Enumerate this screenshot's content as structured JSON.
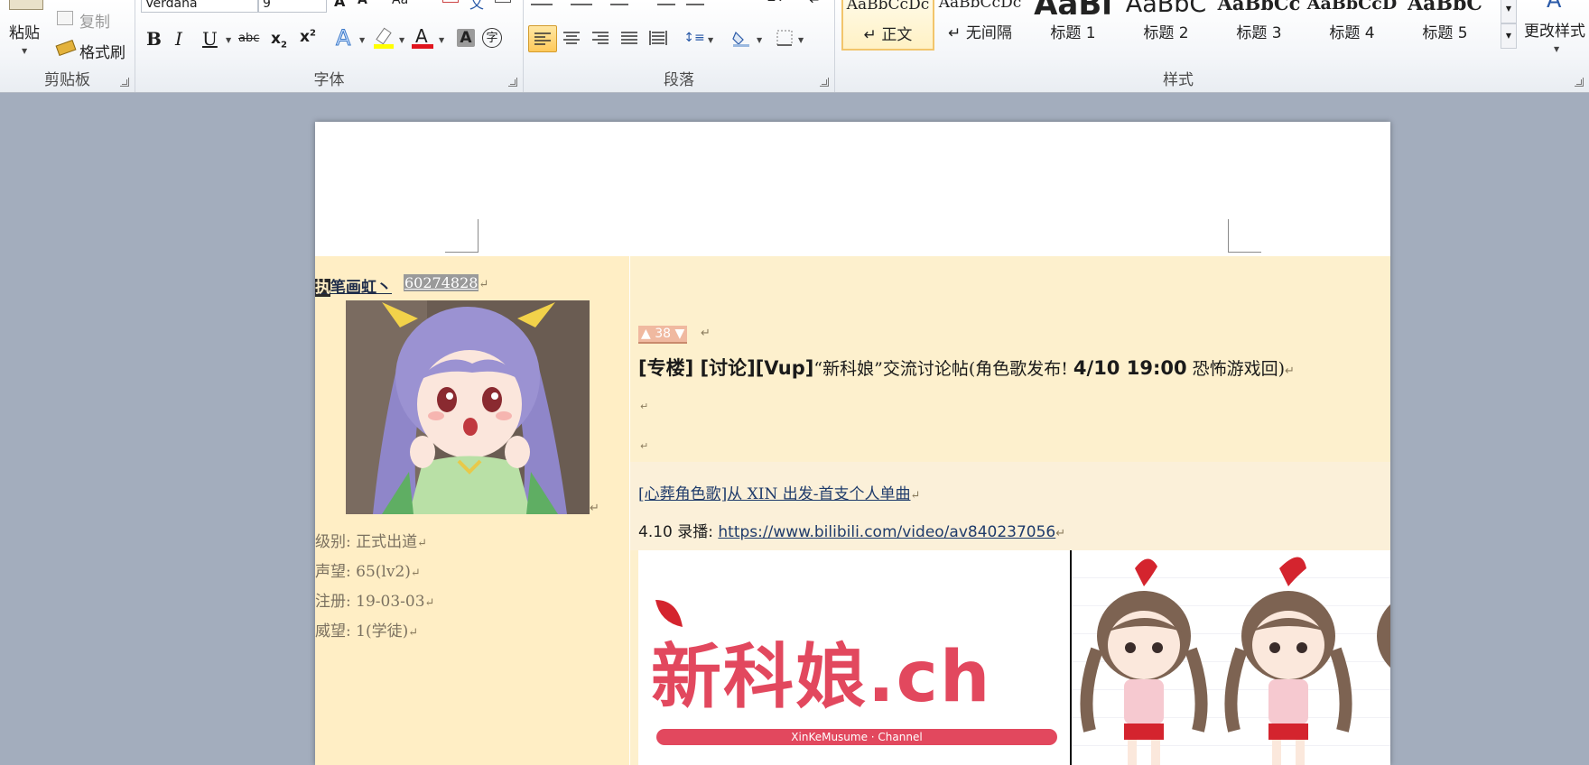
{
  "ribbon": {
    "clipboard": {
      "group_label": "剪贴板",
      "paste_label": "粘贴",
      "copy_label": "复制",
      "format_painter_label": "格式刷"
    },
    "font": {
      "group_label": "字体",
      "font_name": "Verdana",
      "font_size": "9"
    },
    "paragraph": {
      "group_label": "段落"
    },
    "styles": {
      "group_label": "样式",
      "change_styles_label": "更改样式",
      "tiles": [
        {
          "sample": "AaBbCcDc",
          "name": "↵ 正文"
        },
        {
          "sample": "AaBbCcDc",
          "name": "↵ 无间隔"
        },
        {
          "sample": "AaBl",
          "name": "标题 1"
        },
        {
          "sample": "AaBbC",
          "name": "标题 2"
        },
        {
          "sample": "AaBbCc",
          "name": "标题 3"
        },
        {
          "sample": "AaBbCcD",
          "name": "标题 4"
        },
        {
          "sample": "AaBbC",
          "name": "标题 5"
        }
      ]
    },
    "colors": {
      "highlight": "#ffff00",
      "font_color": "#e0151e",
      "accent": "#f2c56b"
    }
  },
  "document": {
    "user": {
      "name_first_char": "执",
      "name_rest": "笔画虹丶",
      "uid": "60274828",
      "level_label": "级别:",
      "level_value": "正式出道",
      "reputation_label": "声望:",
      "reputation_value": "65(lv2)",
      "registered_label": "注册:",
      "registered_value": "19-03-03",
      "prestige_label": "威望:",
      "prestige_value": "1(学徒)"
    },
    "post": {
      "vote_up": "▲",
      "vote_count": "38",
      "vote_down": "▼",
      "title_prefix": "[专楼] [讨论][Vup]",
      "title_main": "“新科娘”交流讨论帖(角色歌发布! ",
      "title_date": "4/10 19:00",
      "title_suffix": " 恐怖游戏回)",
      "song_link": "[心葬角色歌]从 XIN 出发-首支个人单曲",
      "replay_label": "4.10 录播:",
      "replay_url": "https://www.bilibili.com/video/av840237056",
      "banner_logo_text": "新科娘.ch",
      "banner_sub": "XinKeMusume · Channel"
    },
    "para_mark": "↵"
  }
}
